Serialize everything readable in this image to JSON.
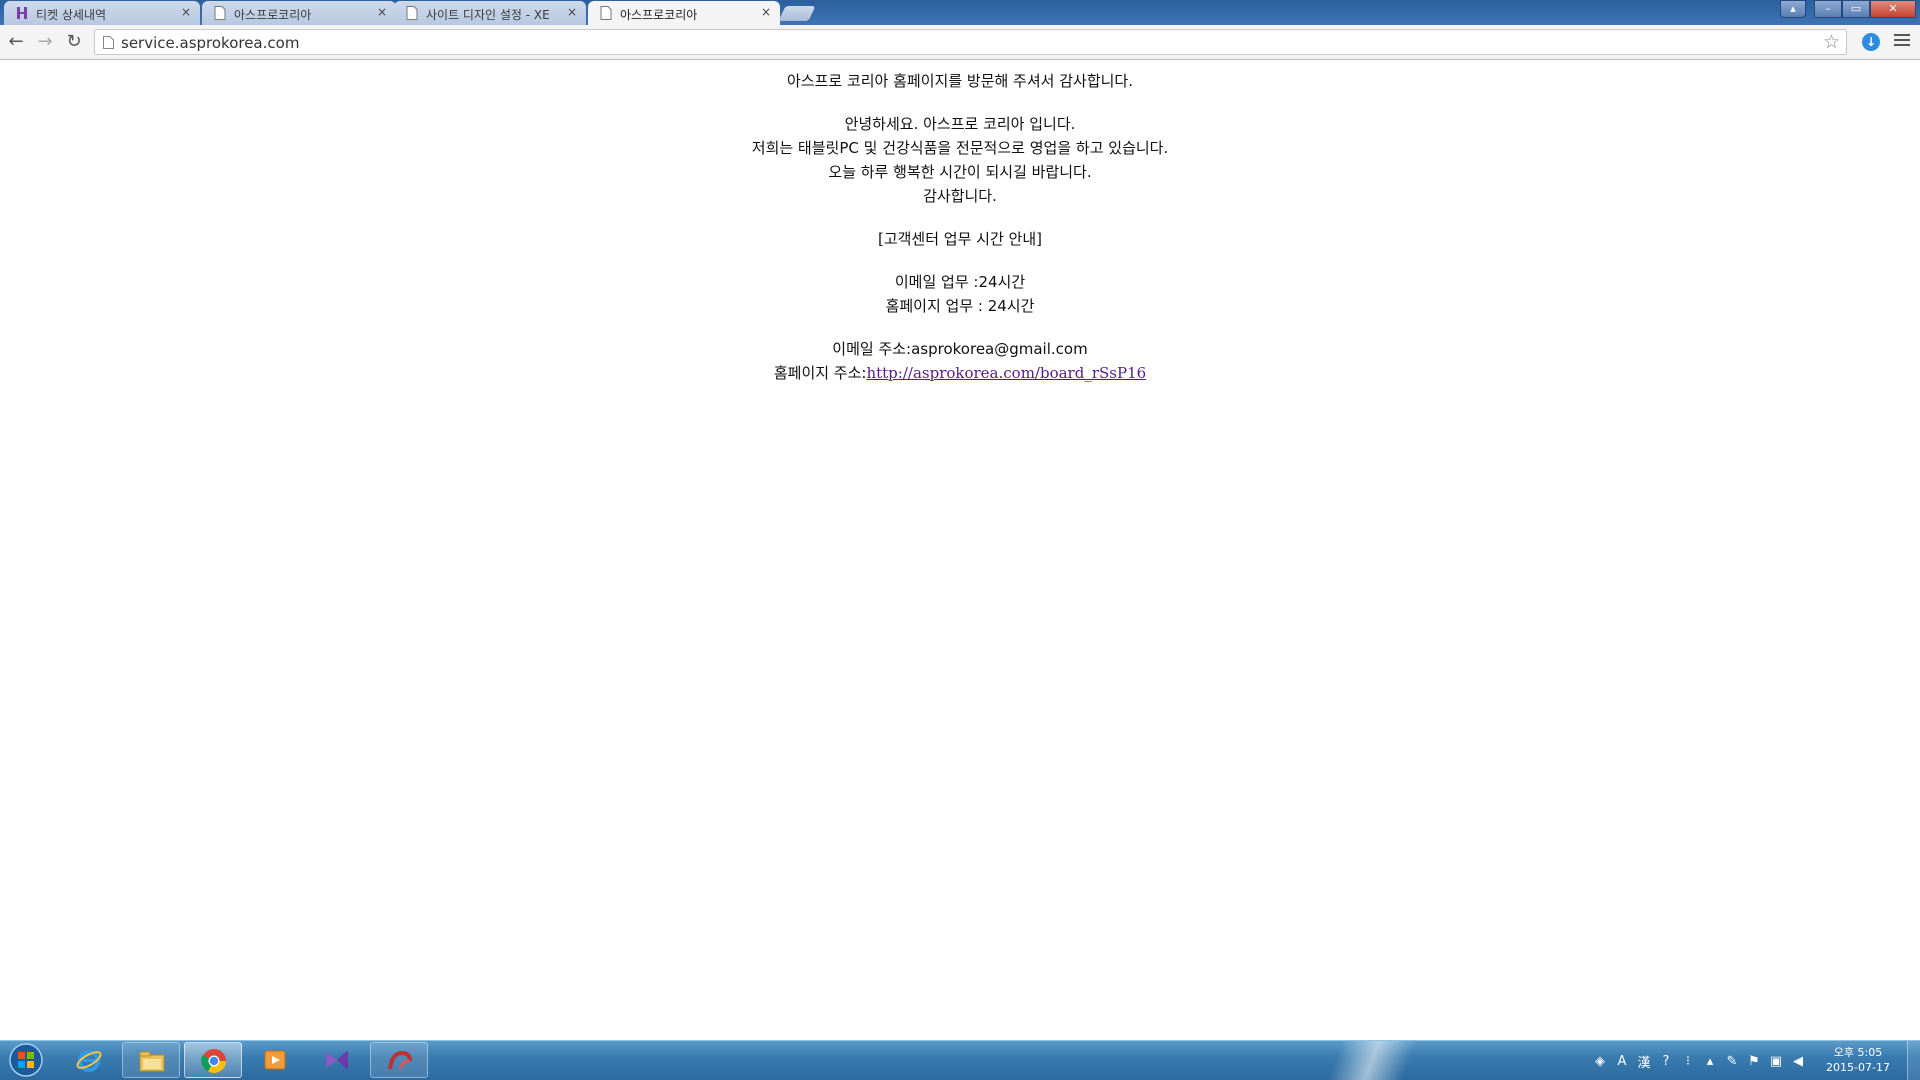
{
  "browser": {
    "tabs": [
      {
        "label": "티켓 상세내역",
        "icon": "hiworks-logo-icon",
        "active": false
      },
      {
        "label": "아스프로코리아",
        "icon": "page-icon",
        "active": false
      },
      {
        "label": "사이트 디자인 설정 - XE",
        "icon": "page-icon",
        "active": false
      },
      {
        "label": "아스프로코리아",
        "icon": "page-icon",
        "active": true
      }
    ],
    "close_glyph": "×",
    "url": "service.asprokorea.com",
    "back_glyph": "←",
    "forward_glyph": "→",
    "reload_glyph": "↻",
    "star_glyph": "☆",
    "extension_glyph": "↓",
    "window_controls": {
      "minimize": "–",
      "maximize": "▭",
      "close": "✕",
      "extra": "▴"
    }
  },
  "page": {
    "welcome": "아스프로 코리아 홈페이지를 방문해 주셔서 감사합니다.",
    "greeting": [
      "안녕하세요. 아스프로 코리아 입니다.",
      "저희는 태블릿PC 및 건강식품을 전문적으로 영업을 하고 있습니다.",
      "오늘 하루 행복한 시간이 되시길 바랍니다.",
      "감사합니다."
    ],
    "hours_title": "[고객센터 업무 시간 안내]",
    "hours": [
      "이메일 업무 :24시간",
      "홈페이지 업무 : 24시간"
    ],
    "email_line": "이메일 주소:asprokorea@gmail.com",
    "homepage_label": "홈페이지 주소:",
    "homepage_link": "http://asprokorea.com/board_rSsP16"
  },
  "taskbar": {
    "apps": [
      "internet-explorer-icon",
      "file-explorer-icon",
      "chrome-icon",
      "media-player-icon",
      "visual-studio-icon",
      "filezilla-icon"
    ],
    "tray_ime": "A",
    "tray_hanja": "漢",
    "tray_help": "?",
    "clock_period_time": "오후 5:05",
    "clock_date": "2015-07-17"
  }
}
